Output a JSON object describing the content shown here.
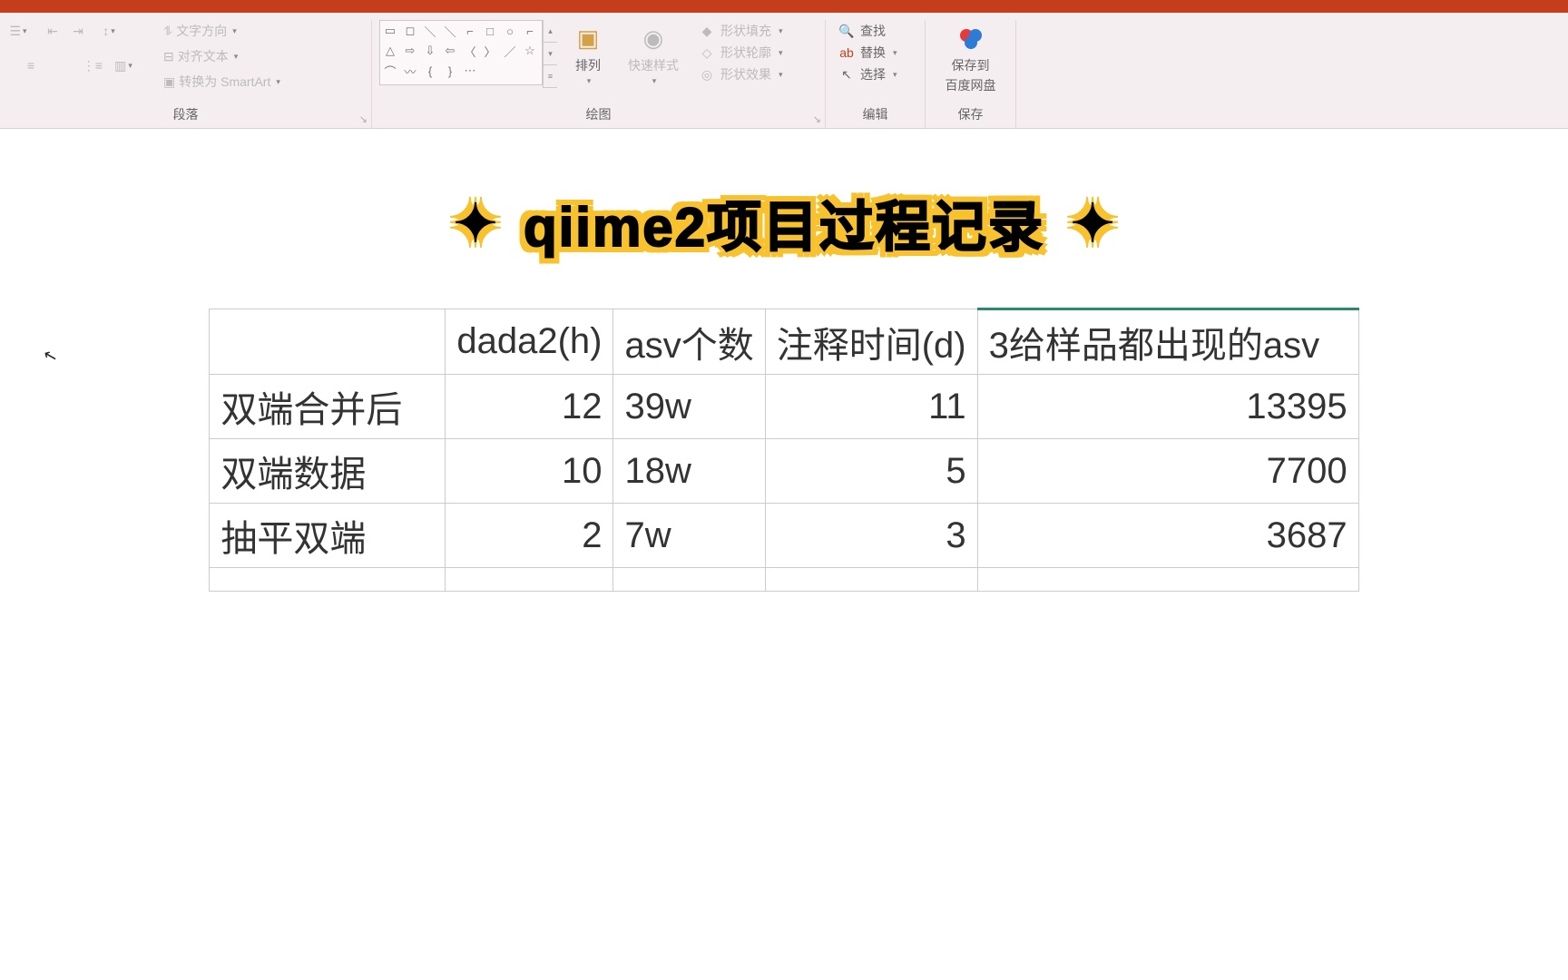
{
  "ribbon": {
    "paragraph": {
      "text_direction": "文字方向",
      "align_text": "对齐文本",
      "convert_smartart": "转换为 SmartArt",
      "group_label": "段落"
    },
    "drawing": {
      "arrange": "排列",
      "quick_styles": "快速样式",
      "shape_fill": "形状填充",
      "shape_outline": "形状轮廓",
      "shape_effects": "形状效果",
      "group_label": "绘图"
    },
    "editing": {
      "find": "查找",
      "replace": "替换",
      "select": "选择",
      "group_label": "编辑"
    },
    "save": {
      "save_to": "保存到",
      "baidu_netdisk": "百度网盘",
      "group_label": "保存"
    }
  },
  "slide": {
    "title": "qiime2项目过程记录",
    "table": {
      "headers": [
        "",
        "dada2(h)",
        "asv个数",
        "注释时间(d)",
        "3给样品都出现的asv"
      ],
      "rows": [
        {
          "label": "双端合并后",
          "dada2": "12",
          "asv": "39w",
          "note_time": "11",
          "asv3": "13395"
        },
        {
          "label": "双端数据",
          "dada2": "10",
          "asv": "18w",
          "note_time": "5",
          "asv3": "7700"
        },
        {
          "label": "抽平双端",
          "dada2": "2",
          "asv": "7w",
          "note_time": "3",
          "asv3": "3687"
        }
      ]
    }
  }
}
